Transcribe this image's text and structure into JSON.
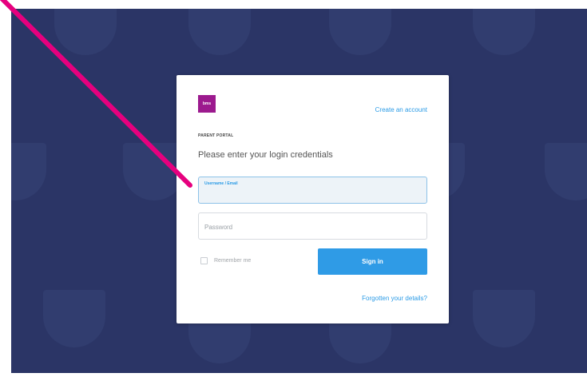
{
  "brand": {
    "logo_text": "bms",
    "logo_color": "#9c1a8e"
  },
  "header": {
    "create_account_label": "Create an account"
  },
  "form": {
    "portal_label": "PARENT PORTAL",
    "heading": "Please enter your login credentials",
    "username": {
      "label": "Username / Email",
      "value": ""
    },
    "password": {
      "placeholder": "Password",
      "value": ""
    },
    "remember_label": "Remember me",
    "remember_checked": false,
    "signin_label": "Sign in",
    "forgot_label": "Forgotten your details?"
  },
  "colors": {
    "background": "#2b3566",
    "accent": "#2f9be6",
    "pointer": "#e6007e"
  }
}
